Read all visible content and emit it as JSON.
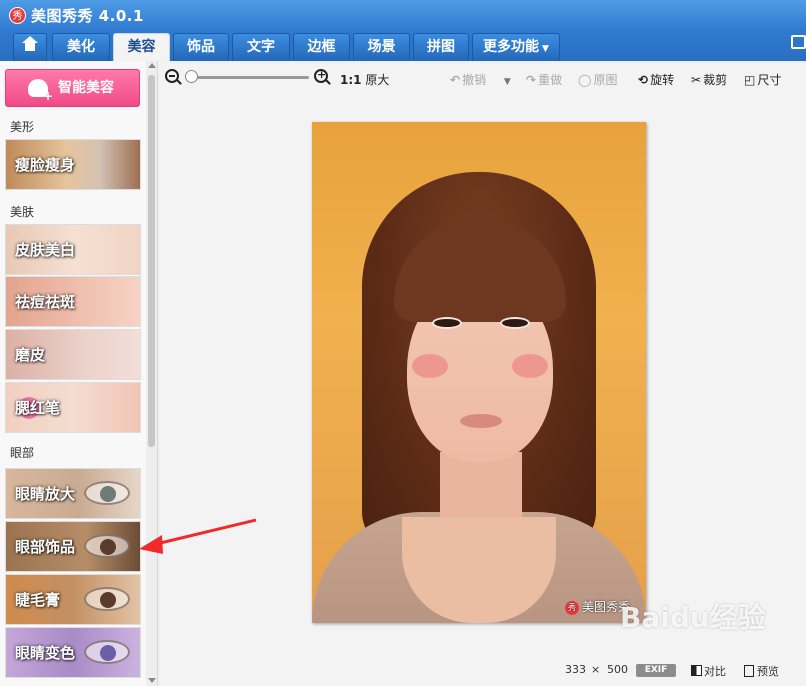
{
  "app": {
    "logo_glyph": "秀",
    "title": "美图秀秀 4.0.1",
    "accent_color": "#2f7ad0",
    "pink_accent": "#f04b86"
  },
  "tabs": [
    {
      "label": "美化"
    },
    {
      "label": "美容",
      "active": true
    },
    {
      "label": "饰品"
    },
    {
      "label": "文字"
    },
    {
      "label": "边框"
    },
    {
      "label": "场景"
    },
    {
      "label": "拼图"
    },
    {
      "label": "更多功能"
    }
  ],
  "sidebar": {
    "smart_button": "智能美容",
    "sections": [
      {
        "title": "美形",
        "items": [
          {
            "label": "瘦脸瘦身"
          }
        ]
      },
      {
        "title": "美肤",
        "items": [
          {
            "label": "皮肤美白"
          },
          {
            "label": "祛痘祛斑"
          },
          {
            "label": "磨皮"
          },
          {
            "label": "腮红笔"
          }
        ]
      },
      {
        "title": "眼部",
        "items": [
          {
            "label": "眼睛放大"
          },
          {
            "label": "眼部饰品"
          },
          {
            "label": "睫毛膏"
          },
          {
            "label": "眼睛变色"
          }
        ]
      }
    ]
  },
  "toolbar": {
    "zoom_ratio": "1:1",
    "original_size": "原大",
    "undo": "撤销",
    "redo": "重做",
    "original": "原图",
    "rotate": "旋转",
    "crop": "裁剪",
    "size": "尺寸"
  },
  "photo": {
    "watermark_logo": "秀",
    "watermark_text": "美图秀秀"
  },
  "status": {
    "width": "333",
    "times": "×",
    "height": "500",
    "exif": "EXIF",
    "compare": "对比",
    "preview": "预览"
  },
  "site_watermark": "Baidu经验"
}
